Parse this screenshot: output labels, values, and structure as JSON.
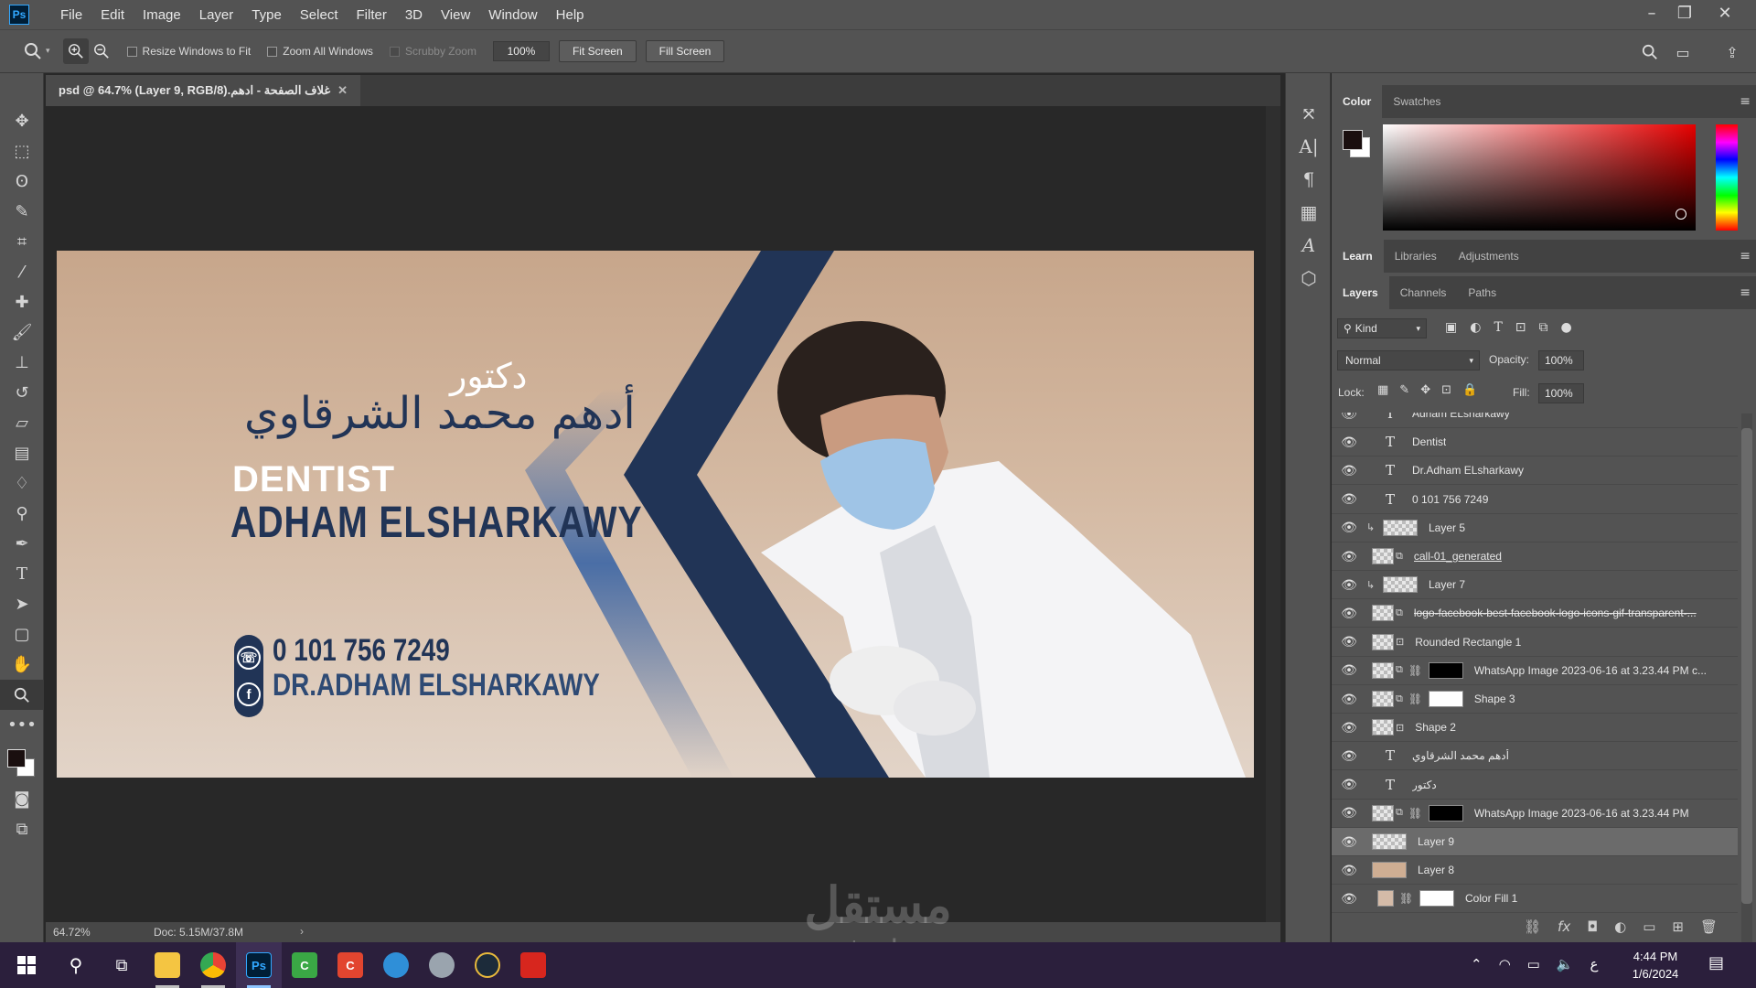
{
  "app": {
    "logo": "Ps",
    "menu": [
      "File",
      "Edit",
      "Image",
      "Layer",
      "Type",
      "Select",
      "Filter",
      "3D",
      "View",
      "Window",
      "Help"
    ]
  },
  "options": {
    "resize_windows": "Resize Windows to Fit",
    "zoom_all": "Zoom All Windows",
    "scrubby_zoom": "Scrubby Zoom",
    "zoom_value": "100%",
    "fit_screen": "Fit Screen",
    "fill_screen": "Fill Screen"
  },
  "document": {
    "tab_title": "غلاف الصفحة - ادهم.psd @ 64.7% (Layer 9, RGB/8)",
    "zoom": "64.72%",
    "doc_size": "Doc: 5.15M/37.8M"
  },
  "artwork": {
    "ar_title": "دكتور",
    "ar_name": "أدهم محمد الشرقاوي",
    "en_title": "DENTIST",
    "en_name": "ADHAM ELSHARKAWY",
    "phone": "0 101 756 7249",
    "facebook": "DR.ADHAM ELSHARKAWY",
    "fb_letter": "f",
    "phone_glyph": "☏"
  },
  "panels": {
    "color_tabs": [
      "Color",
      "Swatches"
    ],
    "learn_tabs": [
      "Learn",
      "Libraries",
      "Adjustments"
    ],
    "layer_tabs": [
      "Layers",
      "Channels",
      "Paths"
    ],
    "kind_label": "Kind",
    "blend_mode": "Normal",
    "opacity_label": "Opacity:",
    "opacity_value": "100%",
    "lock_label": "Lock:",
    "fill_label": "Fill:",
    "fill_value": "100%"
  },
  "layers": [
    {
      "name": "Adham ELsharkawy",
      "kind": "text"
    },
    {
      "name": "Dentist",
      "kind": "text"
    },
    {
      "name": "Dr.Adham ELsharkawy",
      "kind": "text"
    },
    {
      "name": "0 101 756 7249",
      "kind": "text"
    },
    {
      "name": "Layer 5",
      "kind": "clip"
    },
    {
      "name": "call-01_generated",
      "kind": "smart"
    },
    {
      "name": "Layer 7",
      "kind": "clip"
    },
    {
      "name": "logo-facebook-best-facebook-logo-icons-gif-transparent-...",
      "kind": "smart"
    },
    {
      "name": "Rounded Rectangle 1",
      "kind": "shape"
    },
    {
      "name": "WhatsApp Image 2023-06-16 at 3.23.44 PM c...",
      "kind": "masked"
    },
    {
      "name": "Shape 3",
      "kind": "masked"
    },
    {
      "name": "Shape 2",
      "kind": "shape"
    },
    {
      "name": "أدهم محمد الشرقاوي",
      "kind": "text"
    },
    {
      "name": "دكتور",
      "kind": "text"
    },
    {
      "name": "WhatsApp Image 2023-06-16 at 3.23.44 PM",
      "kind": "masked"
    },
    {
      "name": "Layer 9",
      "kind": "pixel",
      "selected": true
    },
    {
      "name": "Layer 8",
      "kind": "pixel"
    },
    {
      "name": "Color Fill 1",
      "kind": "fill"
    }
  ],
  "taskbar": {
    "time": "4:44 PM",
    "date": "1/6/2024",
    "lang": "ع"
  },
  "watermark": {
    "ar": "مستقل",
    "en": "mostaql.com"
  },
  "colors": {
    "foreground": "#1a0f0f",
    "background": "#ffffff",
    "navy": "#213456",
    "accent_blue": "#4a6ea6"
  }
}
